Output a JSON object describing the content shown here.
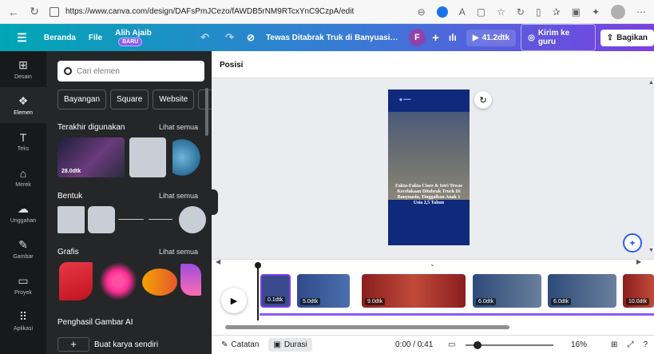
{
  "browser": {
    "url": "https://www.canva.com/design/DAFsPmJCezo/fAWDB5rNM9RTcxYnC9CzpA/edit"
  },
  "topbar": {
    "home": "Beranda",
    "file": "File",
    "magic": "Alih Ajaib",
    "magic_badge": "BARU",
    "doc_title": "Tewas Ditabrak Truk di Banyuasin, Seor...",
    "avatar_letter": "F",
    "present_label": "41.2dtk",
    "send_teacher": "Kirim ke guru",
    "share": "Bagikan"
  },
  "rail": [
    {
      "label": "Desain",
      "icon": "layout-icon"
    },
    {
      "label": "Elemen",
      "icon": "shapes-icon"
    },
    {
      "label": "Teks",
      "icon": "text-icon"
    },
    {
      "label": "Merek",
      "icon": "brand-icon"
    },
    {
      "label": "Unggahan",
      "icon": "upload-icon"
    },
    {
      "label": "Gambar",
      "icon": "draw-icon"
    },
    {
      "label": "Proyek",
      "icon": "folder-icon"
    },
    {
      "label": "Aplikasi",
      "icon": "apps-icon"
    }
  ],
  "panel": {
    "search_placeholder": "Cari elemen",
    "chips": [
      "Bayangan",
      "Square",
      "Website"
    ],
    "recent_title": "Terakhir digunakan",
    "recent_thumb_duration": "28.0dtk",
    "see_all": "Lihat semua",
    "shapes_title": "Bentuk",
    "graphics_title": "Grafis",
    "ai_title": "Penghasil Gambar AI",
    "ai_create": "Buat karya sendiri"
  },
  "canvas": {
    "position_label": "Posisi",
    "design_caption": "Fakta-Fakta Ciore & Istri Tewas Kecelakaan Ditabrak Truck Di Banyuasin, Tinggalkan Anak 1 Usia 2,5 Tahun"
  },
  "timeline": {
    "clips": [
      "0.1dtk",
      "5.0dtk",
      "9.0dtk",
      "6.0dtk",
      "6.0dtk",
      "10.0dtk"
    ]
  },
  "footer": {
    "notes": "Catatan",
    "duration": "Durasi",
    "time": "0:00 / 0:41",
    "zoom": "16%"
  },
  "colors": {
    "accent": "#7b3fe4",
    "topbar_start": "#00a7b5",
    "panel_bg": "#252627"
  }
}
